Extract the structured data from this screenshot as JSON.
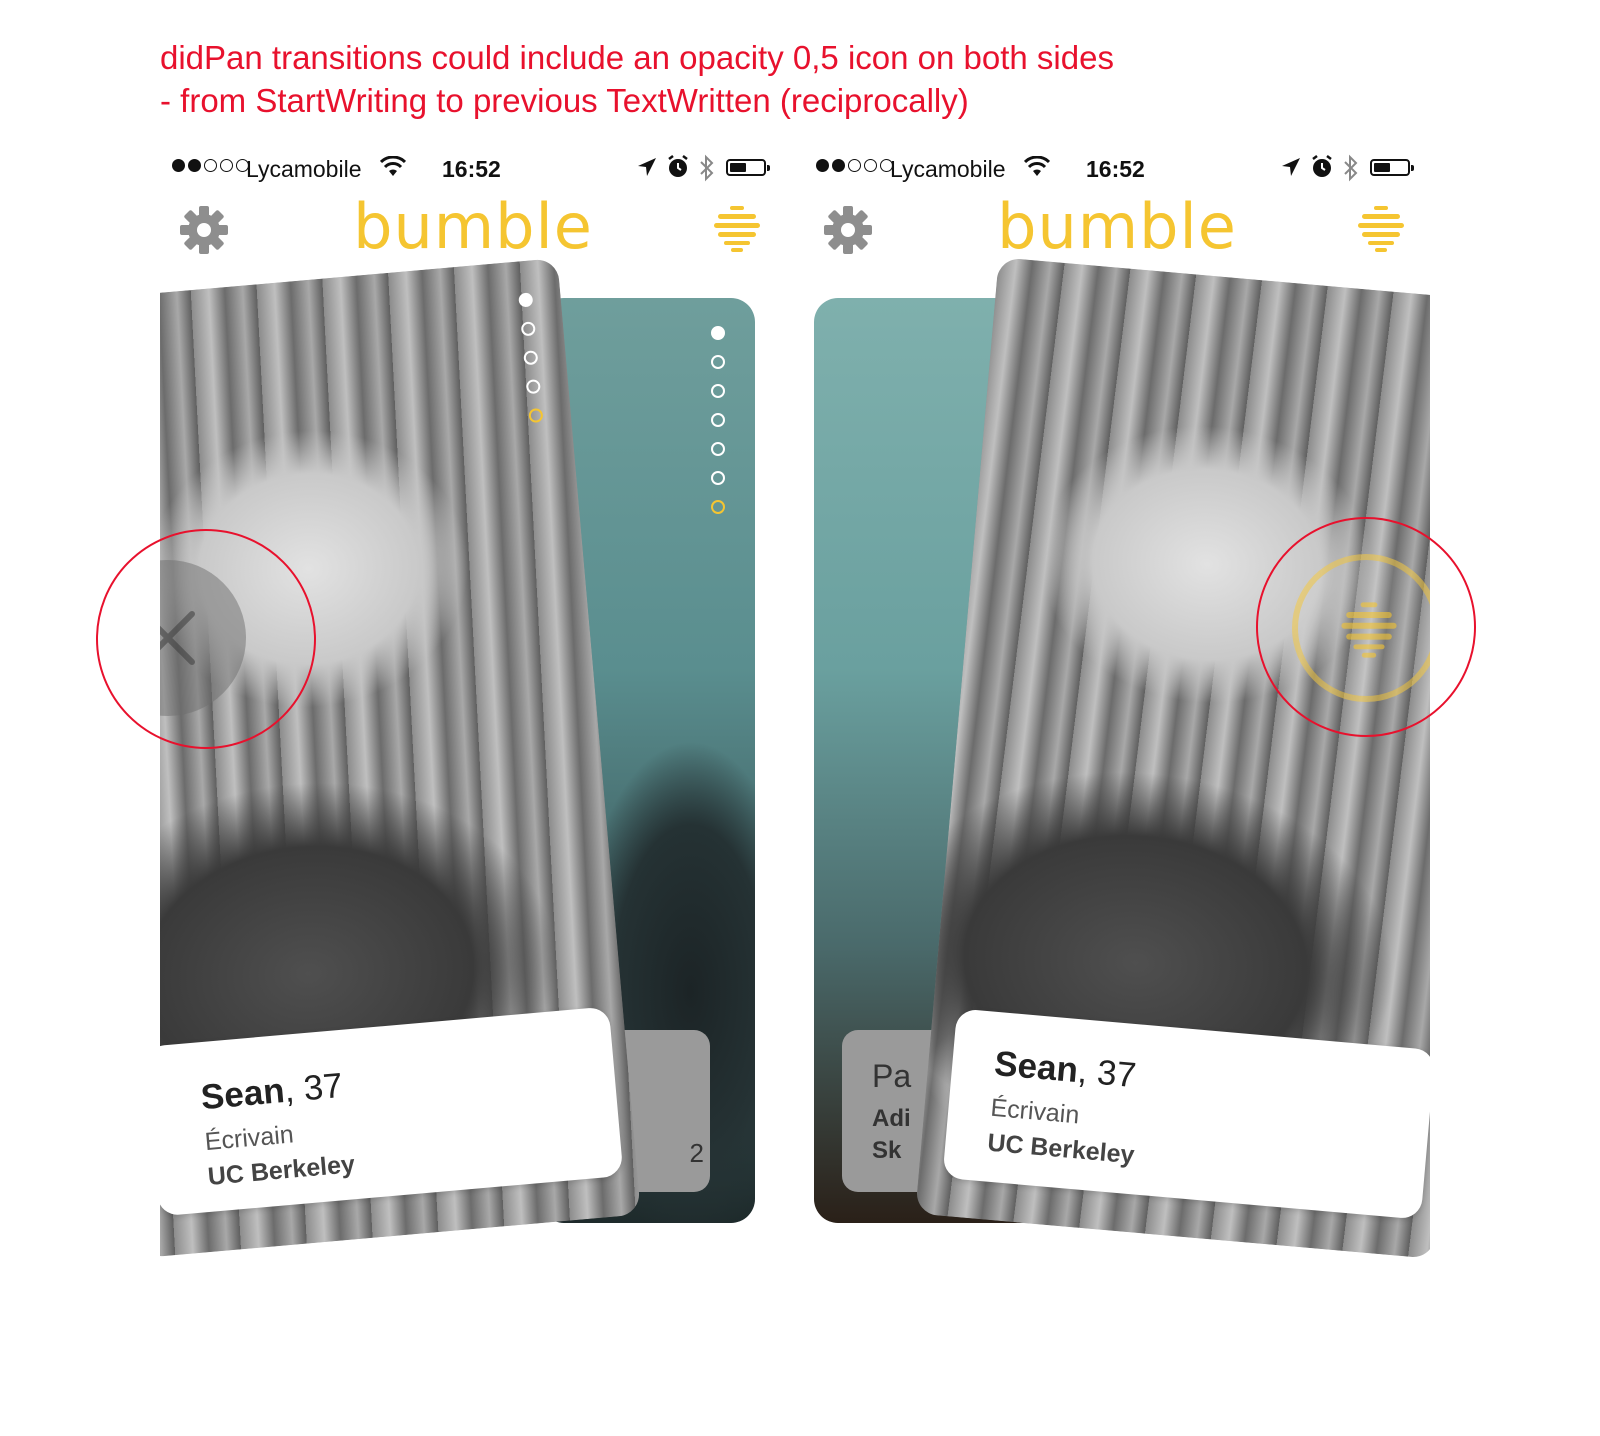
{
  "annotation": {
    "line1": "didPan transitions could include an opacity 0,5 icon on both sides",
    "line2": "- from StartWriting to previous TextWritten (reciprocally)"
  },
  "colors": {
    "annotation": "#e8112d",
    "brand_yellow": "#f5c531",
    "gear_gray": "#8e8e8e"
  },
  "screens": [
    {
      "status": {
        "carrier": "Lycamobile",
        "time": "16:52",
        "signal_bars_filled": 2,
        "signal_bars_total": 5
      },
      "header": {
        "logo": "bumble",
        "settings_icon": "gear-icon",
        "menu_icon": "hive-icon"
      },
      "front_card": {
        "name": "Sean",
        "age": ", 37",
        "job": "Écrivain",
        "school": "UC Berkeley",
        "photo_count": 5,
        "active_photo": 1
      },
      "back_card": {
        "age_fragment": "2",
        "photo_count": 7,
        "active_photo": 1
      },
      "swipe_overlay": {
        "icon": "close-icon",
        "opacity": 0.5,
        "side": "left"
      }
    },
    {
      "status": {
        "carrier": "Lycamobile",
        "time": "16:52",
        "signal_bars_filled": 2,
        "signal_bars_total": 5
      },
      "header": {
        "logo": "bumble",
        "settings_icon": "gear-icon",
        "menu_icon": "hive-icon"
      },
      "front_card": {
        "name": "Sean",
        "age": ", 37",
        "job": "Écrivain",
        "school": "UC Berkeley"
      },
      "back_card": {
        "name_fragment": "Pa",
        "line2_fragment": "Adi",
        "line3_fragment": "Sk"
      },
      "swipe_overlay": {
        "icon": "hive-icon",
        "opacity": 0.5,
        "side": "right"
      }
    }
  ]
}
